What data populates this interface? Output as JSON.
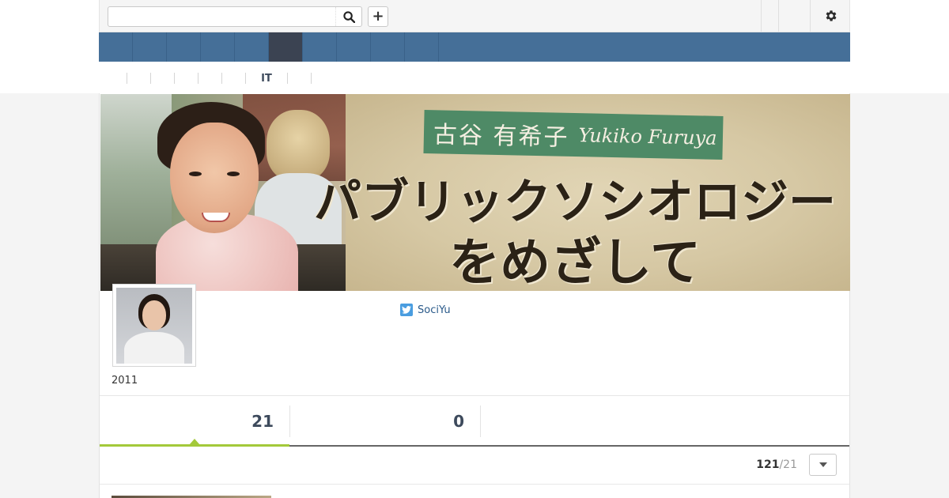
{
  "header": {
    "search": {
      "value": "",
      "placeholder": ""
    },
    "search_icon": "search-icon",
    "add_label": "+",
    "settings_icon": "gear-icon"
  },
  "nav": {
    "tabs": [
      {
        "label": "",
        "active": false
      },
      {
        "label": "",
        "active": false
      },
      {
        "label": "",
        "active": false
      },
      {
        "label": "",
        "active": false
      },
      {
        "label": "",
        "active": false
      },
      {
        "label": "",
        "active": true
      },
      {
        "label": "",
        "active": false
      },
      {
        "label": "",
        "active": false
      },
      {
        "label": "",
        "active": false
      },
      {
        "label": "",
        "active": false
      }
    ],
    "active_color": "#3b4352",
    "bar_color": "#456f98"
  },
  "subnav": {
    "items": [
      "",
      "",
      "",
      "",
      "",
      "",
      "IT",
      ""
    ]
  },
  "banner": {
    "name_jp": "古谷 有希子",
    "name_en": "Yukiko Furuya",
    "title_line1": "パブリックソシオロジー",
    "title_line2": "をめざして"
  },
  "profile": {
    "joined": "2011",
    "twitter_handle": "SociYu",
    "twitter_icon": "twitter-icon"
  },
  "tabs": {
    "first_count": "21",
    "second_count": "0",
    "accent_color": "#a3c93a"
  },
  "pagination": {
    "current": "121",
    "total": "/21",
    "dropdown_icon": "caret-down-icon"
  }
}
